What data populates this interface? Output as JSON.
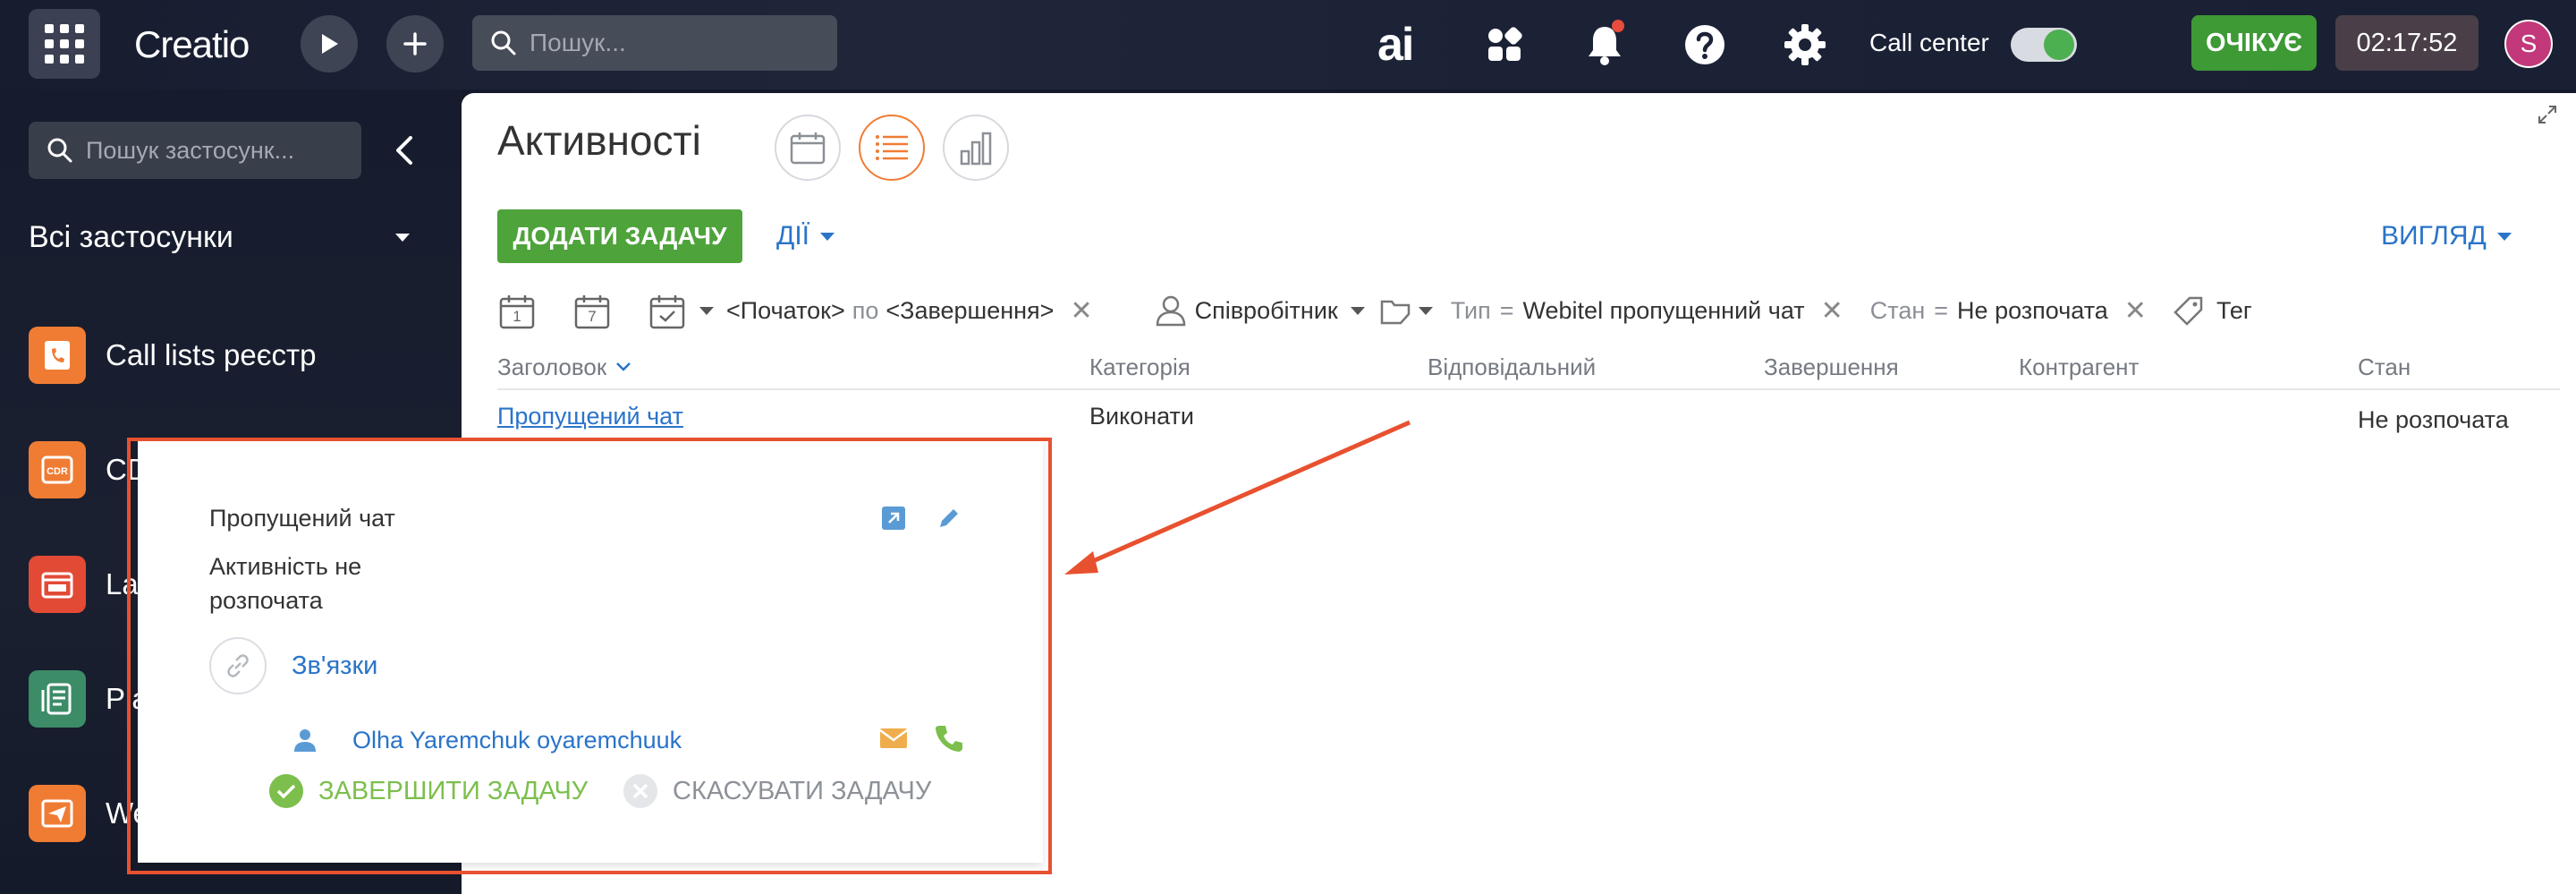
{
  "topbar": {
    "logo": "Creatio",
    "search_placeholder": "Пошук...",
    "ai_label": "ai",
    "callcenter_label": "Call center",
    "status_label": "ОЧІКУЄ",
    "timer": "02:17:52",
    "avatar_initial": "S"
  },
  "sidebar": {
    "search_placeholder": "Пошук застосунк...",
    "all_apps_label": "Всі застосунки",
    "items": [
      {
        "label": "Call lists реєстр",
        "color": "#f07c34"
      },
      {
        "label": "CD",
        "color": "#f07c34"
      },
      {
        "label": "La",
        "color": "#e24a36"
      },
      {
        "label": "Pla",
        "color": "#3c8c68"
      },
      {
        "label": "We",
        "color": "#f07c34"
      }
    ]
  },
  "main": {
    "title": "Активності",
    "add_task_label": "ДОДАТИ ЗАДАЧУ",
    "actions_label": "ДІЇ",
    "view_label": "ВИГЛЯД",
    "filters": {
      "cal_day1": "1",
      "cal_day7": "7",
      "start": "<Початок>",
      "by": "по",
      "end": "<Завершення>",
      "employee": "Співробітник",
      "type_label": "Тип",
      "eq": "=",
      "type_value": "Webitel пропущенний чат",
      "state_label": "Стан",
      "state_value": "Не розпочата",
      "tag_label": "Тег"
    },
    "columns": [
      "Заголовок",
      "Категорія",
      "Відповідальний",
      "Завершення",
      "Контрагент",
      "Стан"
    ],
    "row": {
      "title": "Пропущений чат",
      "category": "Виконати",
      "state": "Не розпочата"
    }
  },
  "popup": {
    "title": "Пропущений чат",
    "status": "Активність не розпочата",
    "links_label": "Зв'язки",
    "person": "Olha Yaremchuk oyaremchuuk",
    "complete_label": "ЗАВЕРШИТИ ЗАДАЧУ",
    "cancel_label": "СКАСУВАТИ ЗАДАЧУ"
  },
  "colors": {
    "accent_blue": "#2a74c9",
    "green": "#4ea33b",
    "orange": "#f07c34",
    "annotation_red": "#e8512f"
  }
}
